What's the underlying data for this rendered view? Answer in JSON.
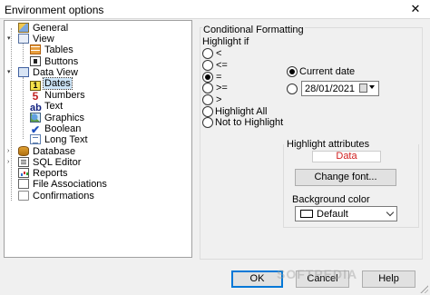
{
  "window": {
    "title": "Environment options",
    "close_glyph": "✕"
  },
  "tree": {
    "items": [
      {
        "label": "General",
        "icon": "general-icon"
      },
      {
        "label": "View",
        "icon": "view-icon"
      },
      {
        "label": "Tables",
        "icon": "tables-icon"
      },
      {
        "label": "Buttons",
        "icon": "buttons-icon"
      },
      {
        "label": "Data View",
        "icon": "data-view-icon"
      },
      {
        "label": "Dates",
        "icon": "dates-icon",
        "selected": true,
        "glyph": "1"
      },
      {
        "label": "Numbers",
        "icon": "numbers-icon",
        "glyph": "5"
      },
      {
        "label": "Text",
        "icon": "text-icon",
        "glyph": "ab"
      },
      {
        "label": "Graphics",
        "icon": "graphics-icon"
      },
      {
        "label": "Boolean",
        "icon": "boolean-icon",
        "glyph": "✔"
      },
      {
        "label": "Long Text",
        "icon": "long-text-icon"
      },
      {
        "label": "Database",
        "icon": "database-icon"
      },
      {
        "label": "SQL Editor",
        "icon": "sql-editor-icon"
      },
      {
        "label": "Reports",
        "icon": "reports-icon"
      },
      {
        "label": "File Associations",
        "icon": "file-associations-icon"
      },
      {
        "label": "Confirmations",
        "icon": "confirmations-icon"
      }
    ]
  },
  "conditional": {
    "group_title": "Conditional Formatting",
    "highlight_if": "Highlight if",
    "operators": [
      "<",
      "<=",
      "=",
      ">=",
      ">"
    ],
    "selected_operator": "=",
    "current_date": "Current date",
    "date_value": "28/01/2021",
    "highlight_all": "Highlight All",
    "not_to_highlight": "Not to Highlight"
  },
  "attributes": {
    "title": "Highlight attributes",
    "sample": "Data",
    "sample_color": "#d02020",
    "change_font": "Change font...",
    "bg_label": "Background color",
    "bg_value": "Default"
  },
  "footer": {
    "ok": "OK",
    "cancel": "Cancel",
    "help": "Help"
  },
  "watermark": "SOFTPEDIA"
}
